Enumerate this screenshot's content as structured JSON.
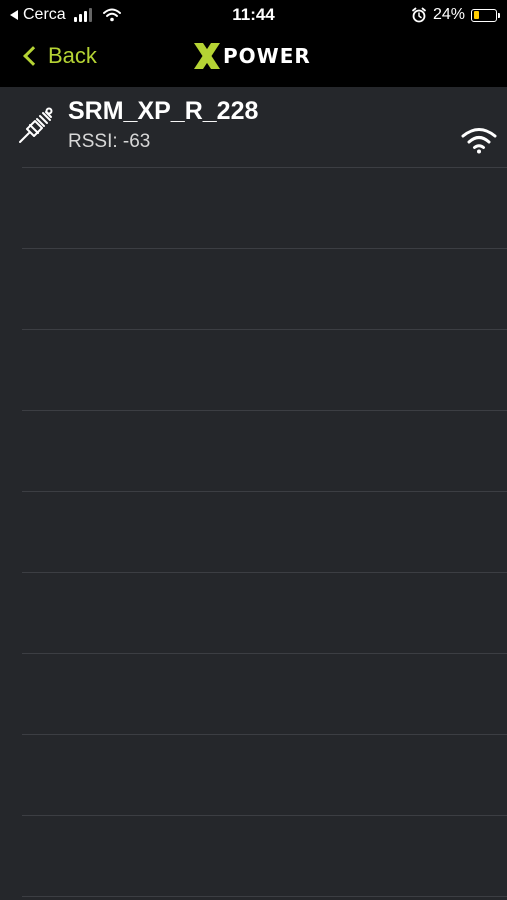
{
  "status_bar": {
    "carrier": "Cerca",
    "time": "11:44",
    "battery_percent": "24%",
    "battery_level": 0.24,
    "battery_color": "#ffcc00",
    "signal_bars_active": 3,
    "icons": [
      "back-to-app-icon",
      "cellular-signal-icon",
      "wifi-status-icon",
      "alarm-icon",
      "battery-icon"
    ]
  },
  "nav": {
    "back_label": "Back",
    "brand_letter": "X",
    "brand_rest": "POWER",
    "accent_color": "#b5d334"
  },
  "devices": [
    {
      "name": "SRM_XP_R_228",
      "rssi": "RSSI: -63",
      "icon": "power-meter-sensor-icon",
      "signal_icon": "wifi-signal-icon"
    }
  ]
}
